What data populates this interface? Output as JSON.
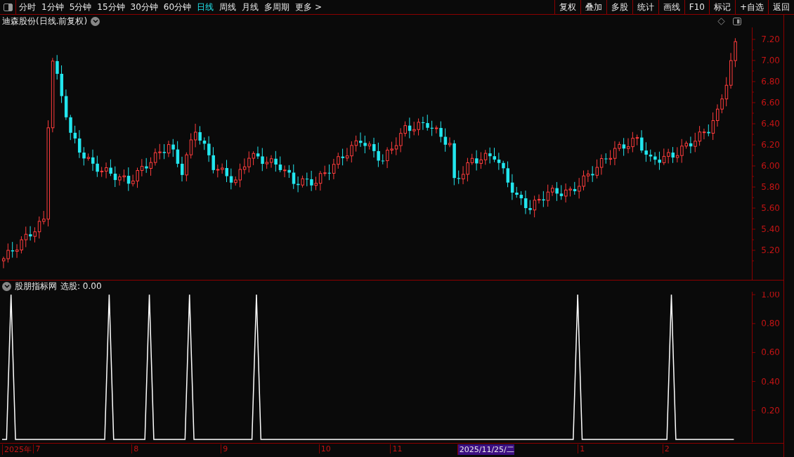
{
  "toolbar": {
    "periods": [
      {
        "label": "分时",
        "selected": false
      },
      {
        "label": "1分钟",
        "selected": false
      },
      {
        "label": "5分钟",
        "selected": false
      },
      {
        "label": "15分钟",
        "selected": false
      },
      {
        "label": "30分钟",
        "selected": false
      },
      {
        "label": "60分钟",
        "selected": false
      },
      {
        "label": "日线",
        "selected": true
      },
      {
        "label": "周线",
        "selected": false
      },
      {
        "label": "月线",
        "selected": false
      },
      {
        "label": "多周期",
        "selected": false
      },
      {
        "label": "更多 >",
        "selected": false
      }
    ],
    "actions": [
      "复权",
      "叠加",
      "多股",
      "统计",
      "画线",
      "F10",
      "标记",
      "+自选",
      "返回"
    ]
  },
  "price_panel": {
    "title": "迪森股份(日线.前复权)",
    "axis_labels": [
      "7.20",
      "7.00",
      "6.80",
      "6.60",
      "6.40",
      "6.20",
      "6.00",
      "5.80",
      "5.60",
      "5.40",
      "5.20"
    ]
  },
  "indicator_panel": {
    "title": "股朋指标网",
    "reading": "选股: 0.00",
    "axis_labels": [
      "1.00",
      "0.80",
      "0.60",
      "0.40",
      "0.20"
    ]
  },
  "date_axis": [
    {
      "label": "2025年",
      "highlight": false
    },
    {
      "label": "7",
      "highlight": false
    },
    {
      "label": "8",
      "highlight": false
    },
    {
      "label": "9",
      "highlight": false
    },
    {
      "label": "10",
      "highlight": false
    },
    {
      "label": "11",
      "highlight": false
    },
    {
      "label": "2025/11/25/二",
      "highlight": true
    },
    {
      "label": "1",
      "highlight": false
    },
    {
      "label": "2",
      "highlight": false
    }
  ]
}
